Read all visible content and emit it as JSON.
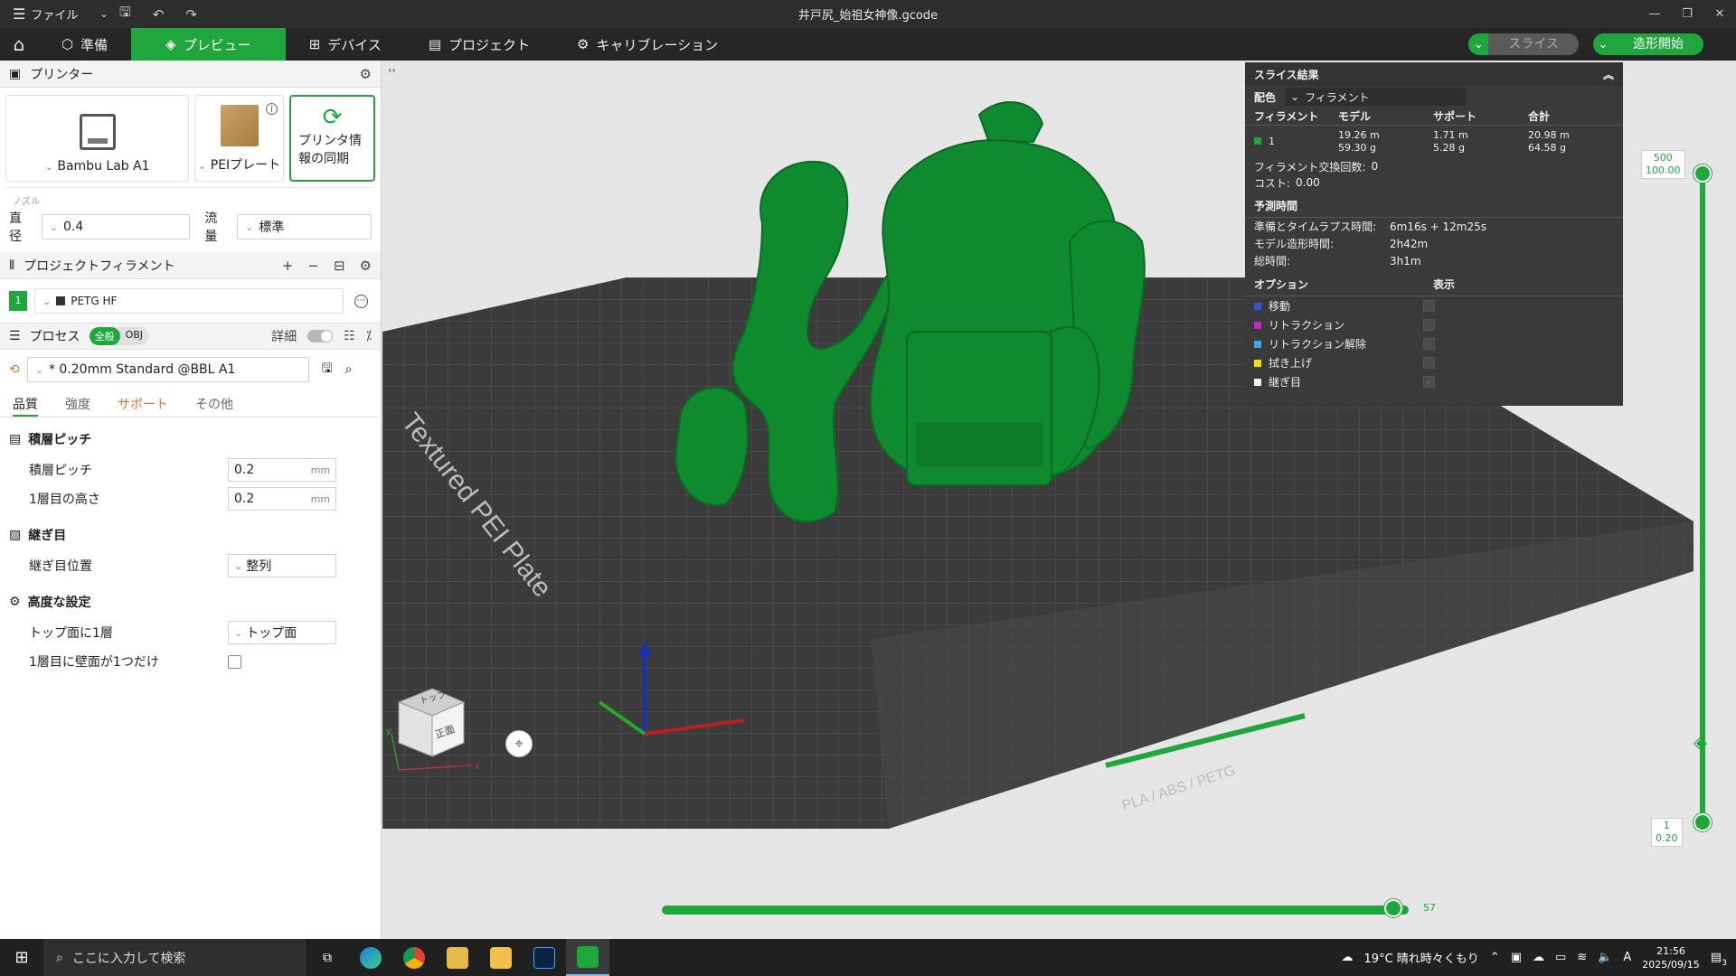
{
  "window": {
    "menu_label": "ファイル",
    "title": "井戸尻_始祖女神像.gcode"
  },
  "tabs": [
    {
      "label": "準備"
    },
    {
      "label": "プレビュー"
    },
    {
      "label": "デバイス"
    },
    {
      "label": "プロジェクト"
    },
    {
      "label": "キャリブレーション"
    }
  ],
  "actions": {
    "slice": "スライス",
    "print": "造形開始"
  },
  "printer": {
    "section_title": "プリンター",
    "model": "Bambu Lab A1",
    "plate": "PEIプレート",
    "sync_label": "プリンタ情報の同期",
    "nozzle_caption": "ノズル",
    "diameter_label": "直径",
    "diameter_value": "0.4",
    "flow_label": "流量",
    "flow_value": "標準"
  },
  "filament": {
    "section_title": "プロジェクトフィラメント",
    "slot": "1",
    "name": "PETG HF",
    "color": "#1a7a2e"
  },
  "process": {
    "section_title": "プロセス",
    "toggle_all": "全般",
    "toggle_obj": "OBJ",
    "detail_label": "詳細",
    "profile": "* 0.20mm Standard @BBL A1",
    "subtabs": [
      "品質",
      "強度",
      "サポート",
      "その他"
    ],
    "groups": {
      "layer": {
        "title": "積層ピッチ",
        "layer_height_label": "積層ピッチ",
        "layer_height_value": "0.2",
        "first_layer_label": "1層目の高さ",
        "first_layer_value": "0.2",
        "unit": "mm"
      },
      "seam": {
        "title": "継ぎ目",
        "position_label": "継ぎ目位置",
        "position_value": "整列"
      },
      "advanced": {
        "title": "高度な設定",
        "top_one_wall_label": "トップ面に1層",
        "top_one_wall_value": "トップ面",
        "first_layer_one_wall_label": "1層目に壁面が1つだけ"
      }
    }
  },
  "results": {
    "title": "スライス結果",
    "color_scheme_label": "配色",
    "color_scheme_value": "フィラメント",
    "headers": [
      "フィラメント",
      "モデル",
      "サポート",
      "合計"
    ],
    "row": {
      "id": "1",
      "model_len": "19.26 m",
      "model_wt": "59.30 g",
      "support_len": "1.71 m",
      "support_wt": "5.28 g",
      "total_len": "20.98 m",
      "total_wt": "64.58 g"
    },
    "changes_label": "フィラメント交換回数:",
    "changes_value": "0",
    "cost_label": "コスト:",
    "cost_value": "0.00",
    "time_title": "予測時間",
    "prep_label": "準備とタイムラプス時間:",
    "prep_value": "6m16s + 12m25s",
    "model_time_label": "モデル造形時間:",
    "model_time_value": "2h42m",
    "total_time_label": "総時間:",
    "total_time_value": "3h1m",
    "options_title": "オプション",
    "display_title": "表示",
    "options": [
      {
        "label": "移動",
        "color": "#3b4fd8",
        "checked": false
      },
      {
        "label": "リトラクション",
        "color": "#c428c4",
        "checked": false
      },
      {
        "label": "リトラクション解除",
        "color": "#3aa7e0",
        "checked": false
      },
      {
        "label": "拭き上げ",
        "color": "#f0e000",
        "checked": false
      },
      {
        "label": "継ぎ目",
        "color": "#f0f0f0",
        "checked": true
      }
    ]
  },
  "slider": {
    "top_layer": "500",
    "top_height": "100.00",
    "bottom_layer": "1",
    "bottom_height": "0.20",
    "h_value": "57",
    "h_fraction": 0.98,
    "v_top_fraction": 1.0,
    "v_bottom_fraction": 0.0
  },
  "plate_text": "Textured PEI Plate",
  "plate_label": "PLA / ABS / PETG",
  "cube": {
    "top": "トップ",
    "front": "正面",
    "axis_x": "x",
    "axis_y": "y"
  },
  "taskbar": {
    "search_placeholder": "ここに入力して検索",
    "weather": "19°C 晴れ時々くもり",
    "time": "21:56",
    "date": "2025/09/15",
    "notif_count": "3",
    "lang": "A"
  }
}
